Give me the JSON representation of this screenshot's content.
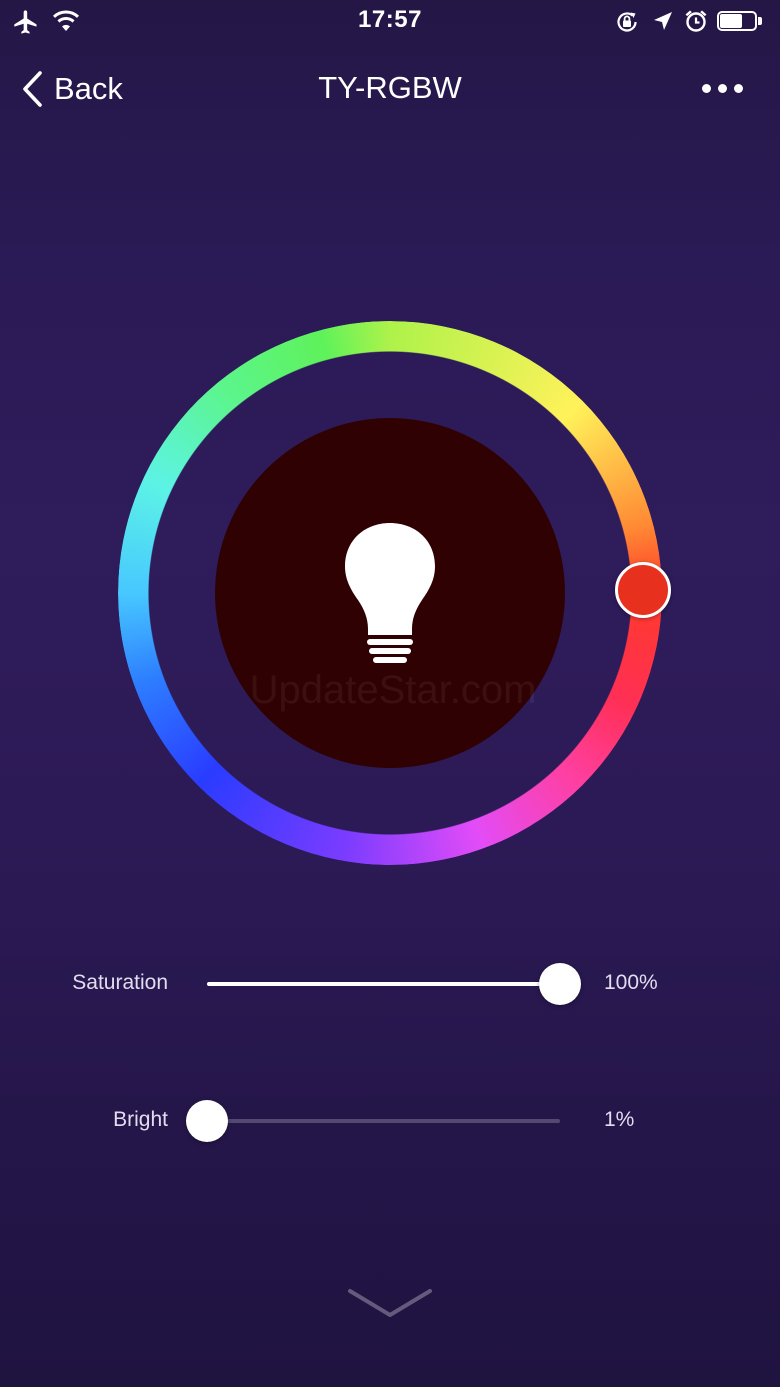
{
  "status_bar": {
    "time": "17:57",
    "left_icons": [
      "airplane-mode-icon",
      "wifi-icon"
    ],
    "right_icons": [
      "orientation-lock-icon",
      "location-arrow-icon",
      "alarm-clock-icon",
      "battery-icon"
    ],
    "battery_level": 0.65
  },
  "nav": {
    "back_label": "Back",
    "title": "TY-RGBW",
    "more_icon": "more-dots-icon"
  },
  "color_wheel": {
    "selected_color": "#e8301f",
    "preview_color": "#300102",
    "center_icon": "light-bulb-icon"
  },
  "sliders": {
    "saturation": {
      "label": "Saturation",
      "value_text": "100%",
      "value": 1.0
    },
    "bright": {
      "label": "Bright",
      "value_text": "1%",
      "value": 0.0
    }
  },
  "watermark": "UpdateStar.com",
  "bottom": {
    "collapse_icon": "chevron-down-icon"
  }
}
